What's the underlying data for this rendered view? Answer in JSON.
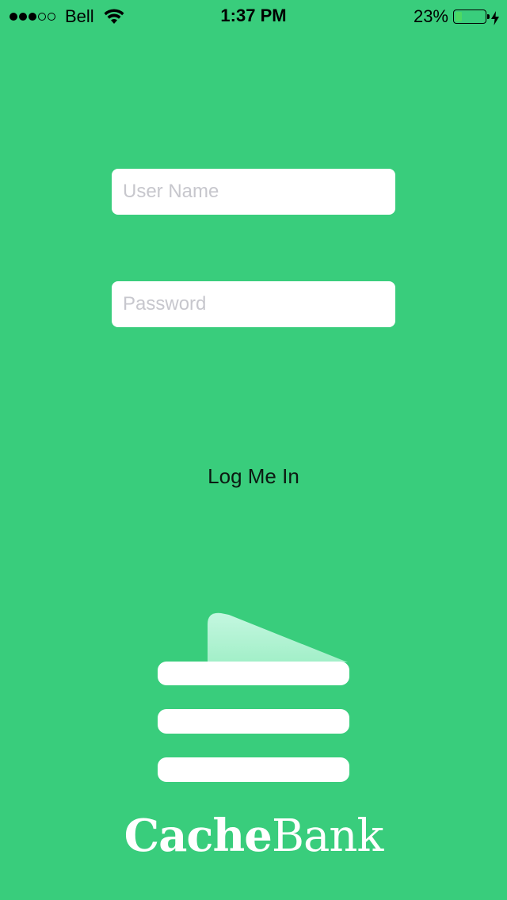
{
  "status_bar": {
    "carrier": "Bell",
    "time": "1:37 PM",
    "battery_percent": "23%",
    "battery_level": 0.23,
    "signal_strength": 3,
    "signal_max": 5,
    "icons": [
      "signal-dots",
      "wifi-icon",
      "battery-icon",
      "charging-bolt-icon"
    ]
  },
  "login_form": {
    "username_placeholder": "User Name",
    "username_value": "",
    "password_placeholder": "Password",
    "password_value": "",
    "submit_label": "Log Me In"
  },
  "branding": {
    "name_part1": "Cache",
    "name_part2": "Bank",
    "logo_icon": "cachebank-logo-icon"
  },
  "colors": {
    "background": "#39CD7C",
    "field_background": "#FFFFFF",
    "placeholder": "#C7C7CD",
    "logo_flap": "#B6F5D6",
    "battery_fill": "#4CD964"
  }
}
